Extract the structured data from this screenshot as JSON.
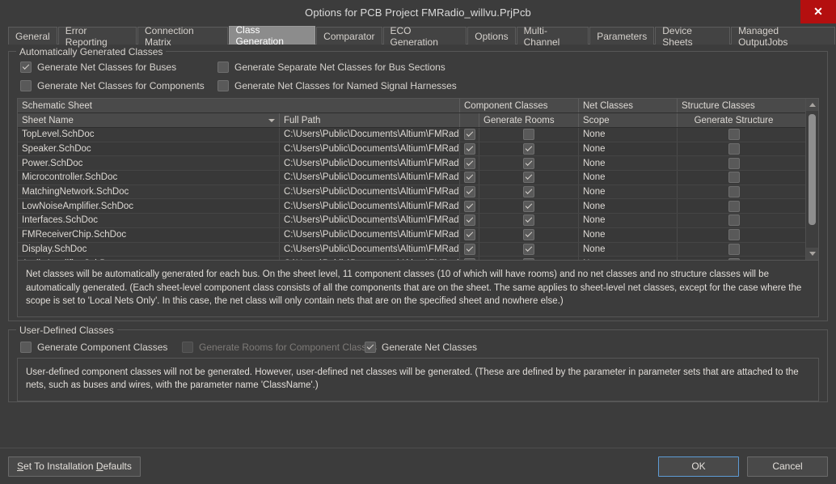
{
  "window": {
    "title": "Options for PCB Project FMRadio_willvu.PrjPcb",
    "close_label": "✕"
  },
  "tabs": [
    {
      "label": "General",
      "active": false
    },
    {
      "label": "Error Reporting",
      "active": false
    },
    {
      "label": "Connection Matrix",
      "active": false
    },
    {
      "label": "Class Generation",
      "active": true
    },
    {
      "label": "Comparator",
      "active": false
    },
    {
      "label": "ECO Generation",
      "active": false
    },
    {
      "label": "Options",
      "active": false
    },
    {
      "label": "Multi-Channel",
      "active": false
    },
    {
      "label": "Parameters",
      "active": false
    },
    {
      "label": "Device Sheets",
      "active": false
    },
    {
      "label": "Managed OutputJobs",
      "active": false
    }
  ],
  "auto_group": {
    "title": "Automatically Generated Classes",
    "checkboxes": [
      {
        "label": "Generate Net Classes for Buses",
        "checked": true
      },
      {
        "label": "Generate Separate Net Classes for Bus Sections",
        "checked": false
      },
      {
        "label": "Generate Net Classes for Components",
        "checked": false
      },
      {
        "label": "Generate Net Classes for Named Signal Harnesses",
        "checked": false
      }
    ]
  },
  "table": {
    "group_headers": [
      {
        "label": "Schematic Sheet"
      },
      {
        "label": "Component Classes"
      },
      {
        "label": "Net Classes"
      },
      {
        "label": "Structure Classes"
      }
    ],
    "columns": [
      {
        "label": "Sheet Name",
        "sorted": true
      },
      {
        "label": "Full Path"
      },
      {
        "label": ""
      },
      {
        "label": "Generate Rooms"
      },
      {
        "label": "Scope"
      },
      {
        "label": "Generate Structure"
      }
    ],
    "rows": [
      {
        "sheet_name": "TopLevel.SchDoc",
        "full_path": "C:\\Users\\Public\\Documents\\Altium\\FMRadi",
        "component_class": true,
        "generate_rooms": false,
        "scope": "None",
        "generate_structure": false
      },
      {
        "sheet_name": "Speaker.SchDoc",
        "full_path": "C:\\Users\\Public\\Documents\\Altium\\FMRadi",
        "component_class": true,
        "generate_rooms": true,
        "scope": "None",
        "generate_structure": false
      },
      {
        "sheet_name": "Power.SchDoc",
        "full_path": "C:\\Users\\Public\\Documents\\Altium\\FMRadi",
        "component_class": true,
        "generate_rooms": true,
        "scope": "None",
        "generate_structure": false
      },
      {
        "sheet_name": "Microcontroller.SchDoc",
        "full_path": "C:\\Users\\Public\\Documents\\Altium\\FMRadi",
        "component_class": true,
        "generate_rooms": true,
        "scope": "None",
        "generate_structure": false
      },
      {
        "sheet_name": "MatchingNetwork.SchDoc",
        "full_path": "C:\\Users\\Public\\Documents\\Altium\\FMRadi",
        "component_class": true,
        "generate_rooms": true,
        "scope": "None",
        "generate_structure": false
      },
      {
        "sheet_name": "LowNoiseAmplifier.SchDoc",
        "full_path": "C:\\Users\\Public\\Documents\\Altium\\FMRadi",
        "component_class": true,
        "generate_rooms": true,
        "scope": "None",
        "generate_structure": false
      },
      {
        "sheet_name": "Interfaces.SchDoc",
        "full_path": "C:\\Users\\Public\\Documents\\Altium\\FMRadi",
        "component_class": true,
        "generate_rooms": true,
        "scope": "None",
        "generate_structure": false
      },
      {
        "sheet_name": "FMReceiverChip.SchDoc",
        "full_path": "C:\\Users\\Public\\Documents\\Altium\\FMRadi",
        "component_class": true,
        "generate_rooms": true,
        "scope": "None",
        "generate_structure": false
      },
      {
        "sheet_name": "Display.SchDoc",
        "full_path": "C:\\Users\\Public\\Documents\\Altium\\FMRadi",
        "component_class": true,
        "generate_rooms": true,
        "scope": "None",
        "generate_structure": false
      },
      {
        "sheet_name": "AudioAmplifier.SchDoc",
        "full_path": "C:\\Users\\Public\\Documents\\Altium\\FMRadi",
        "component_class": true,
        "generate_rooms": true,
        "scope": "None",
        "generate_structure": false
      }
    ]
  },
  "auto_description": "Net classes will be automatically generated for each bus. On the sheet level, 11 component classes (10 of which will have rooms) and no net classes and no structure classes will be automatically generated. (Each sheet-level component class consists of all the components that are on the sheet. The same applies to sheet-level net classes, except for the case where the scope is set to 'Local Nets Only'. In this case, the net class will only contain nets that are on the specified sheet and nowhere else.)",
  "user_group": {
    "title": "User-Defined Classes",
    "checkboxes": [
      {
        "label": "Generate Component Classes",
        "checked": false,
        "disabled": false
      },
      {
        "label": "Generate Rooms for Component Classes",
        "checked": false,
        "disabled": true
      },
      {
        "label": "Generate Net Classes",
        "checked": true,
        "disabled": false
      }
    ],
    "description": "User-defined component classes will not be generated. However, user-defined net classes will be generated. (These are defined by the parameter in parameter sets that are attached to the nets, such as buses and wires, with the parameter name 'ClassName'.)"
  },
  "footer": {
    "defaults_label": "Set To Installation Defaults",
    "ok_label": "OK",
    "cancel_label": "Cancel"
  },
  "colors": {
    "close_red": "#b40f0f",
    "focus_blue": "#5d9bd5",
    "window_bg": "#3c3c3c",
    "active_tab_bg": "#8c8c8c"
  }
}
